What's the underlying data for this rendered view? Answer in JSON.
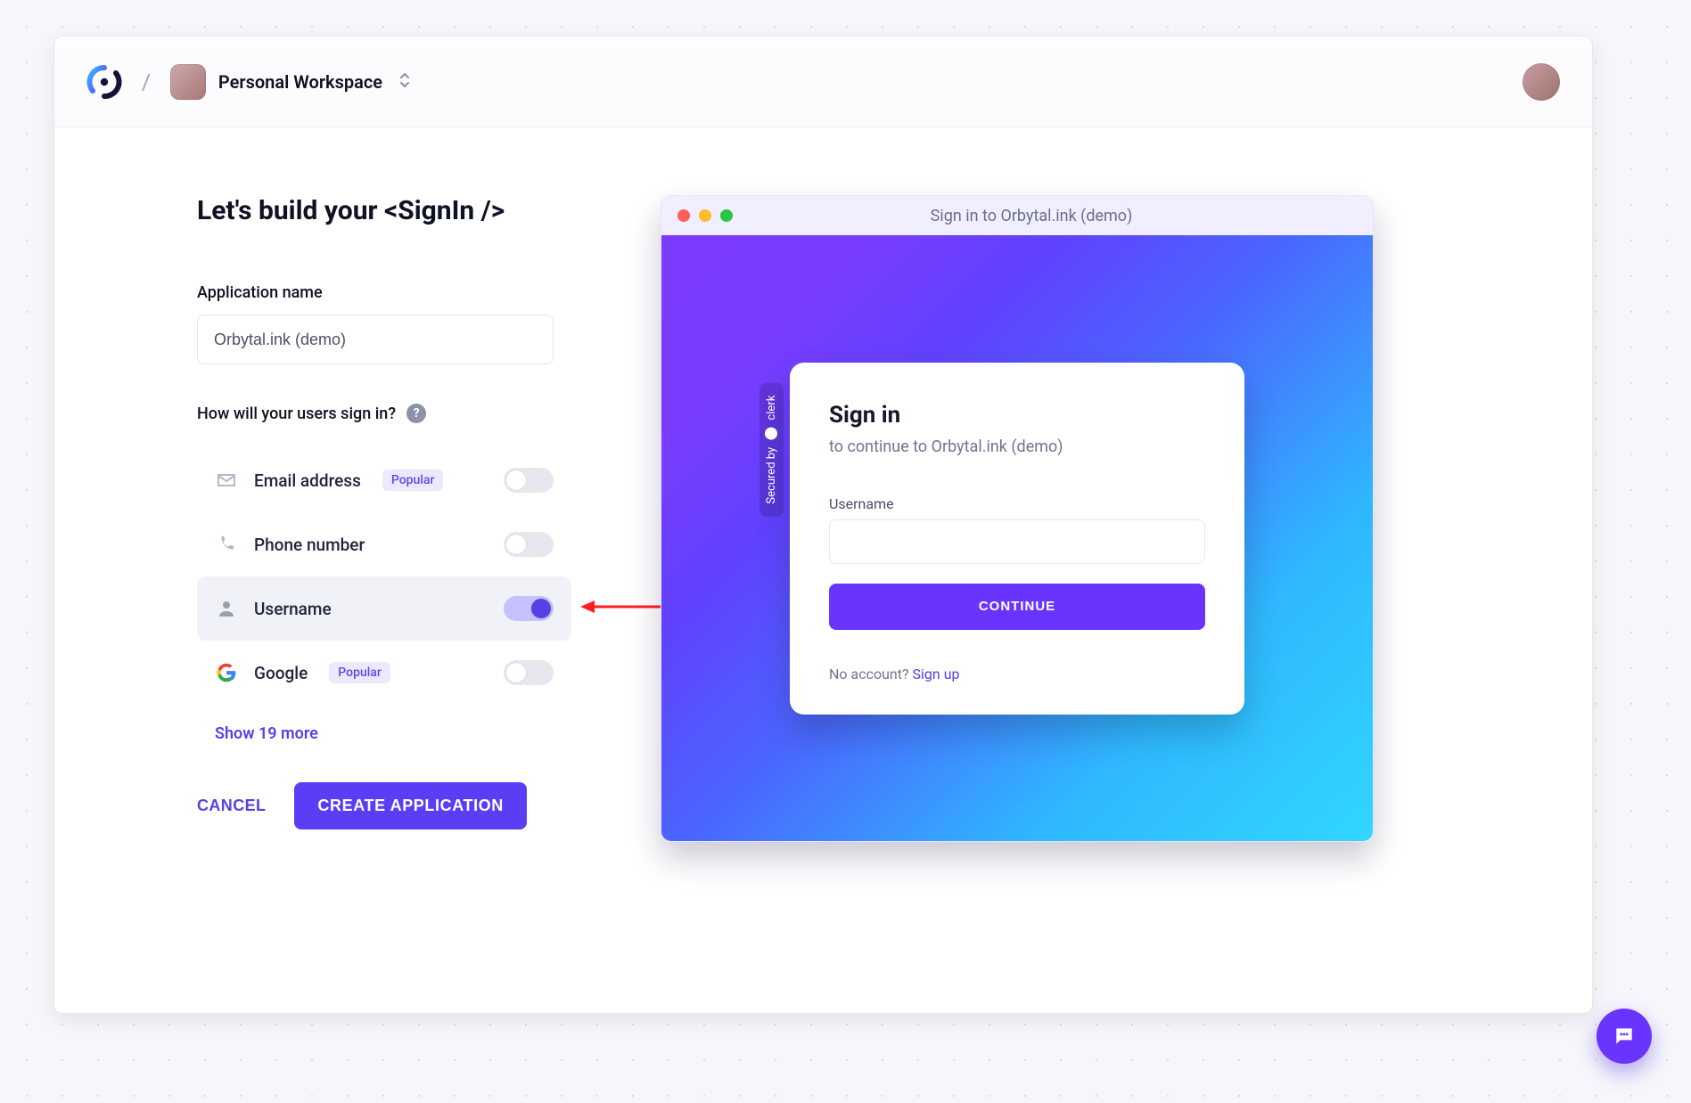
{
  "header": {
    "workspace_label": "Personal Workspace"
  },
  "build": {
    "title_prefix": "Let's build your ",
    "title_tag": "<SignIn />",
    "app_name_label": "Application name",
    "app_name_value": "Orbytal.ink (demo)",
    "signIn_question": "How will your users sign in?",
    "show_more": "Show 19 more",
    "cancel": "CANCEL",
    "create": "CREATE APPLICATION",
    "options": {
      "email": {
        "label": "Email address",
        "popular": "Popular",
        "on": false
      },
      "phone": {
        "label": "Phone number",
        "on": false
      },
      "username": {
        "label": "Username",
        "on": true
      },
      "google": {
        "label": "Google",
        "popular": "Popular",
        "on": false
      }
    }
  },
  "preview": {
    "window_title": "Sign in to Orbytal.ink (demo)",
    "secured_by": "Secured by",
    "secured_brand": "clerk",
    "card": {
      "heading": "Sign in",
      "sub_prefix": "to continue to ",
      "sub_app": "Orbytal.ink (demo)",
      "field_label": "Username",
      "continue": "CONTINUE",
      "no_account": "No account? ",
      "signup": "Sign up"
    }
  }
}
